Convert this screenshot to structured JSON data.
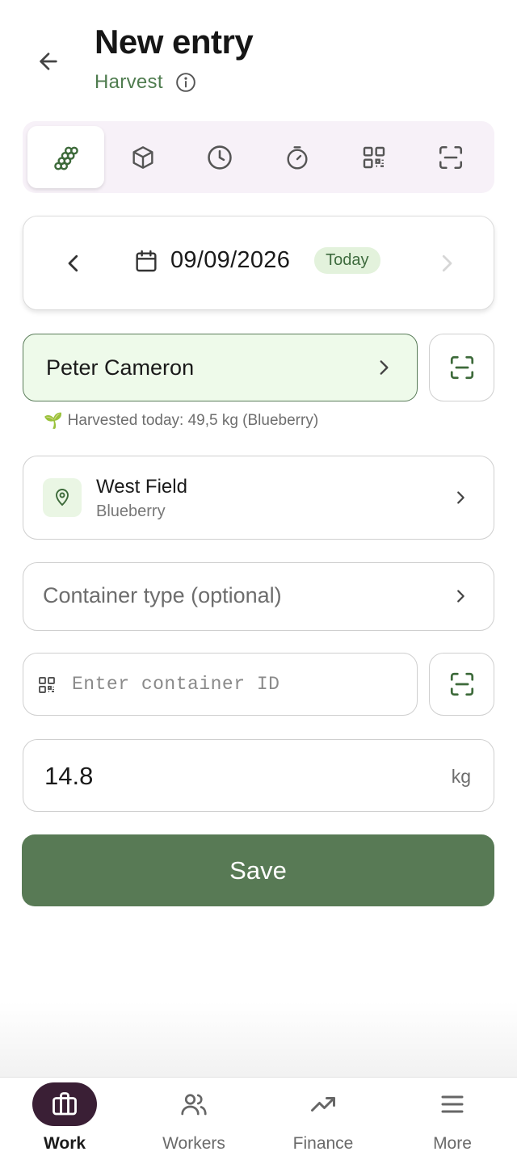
{
  "header": {
    "title": "New entry",
    "subtitle": "Harvest",
    "back_icon": "arrow-left-icon",
    "info_icon": "info-icon"
  },
  "entry_types": [
    {
      "icon": "grapes-icon",
      "active": true
    },
    {
      "icon": "box-icon",
      "active": false
    },
    {
      "icon": "clock-icon",
      "active": false
    },
    {
      "icon": "stopwatch-icon",
      "active": false
    },
    {
      "icon": "qr-code-icon",
      "active": false
    },
    {
      "icon": "scan-icon",
      "active": false
    }
  ],
  "date": {
    "value": "09/09/2026",
    "badge": "Today"
  },
  "worker": {
    "name": "Peter Cameron",
    "note_emoji": "🌱",
    "note": "Harvested today: 49,5 kg (Blueberry)"
  },
  "field": {
    "name": "West Field",
    "crop": "Blueberry"
  },
  "container_type": {
    "placeholder": "Container type (optional)"
  },
  "container_id": {
    "placeholder": "Enter container ID",
    "value": ""
  },
  "weight": {
    "value": "14.8",
    "unit": "kg"
  },
  "save_label": "Save",
  "colors": {
    "brand_green": "#587a55",
    "nav_active": "#3a1f35",
    "tab_bg": "#f7f1f8",
    "worker_bg": "#eefaea"
  },
  "nav": {
    "items": [
      {
        "label": "Work",
        "icon": "briefcase-icon",
        "active": true
      },
      {
        "label": "Workers",
        "icon": "users-icon",
        "active": false
      },
      {
        "label": "Finance",
        "icon": "trending-up-icon",
        "active": false
      },
      {
        "label": "More",
        "icon": "menu-icon",
        "active": false
      }
    ]
  }
}
